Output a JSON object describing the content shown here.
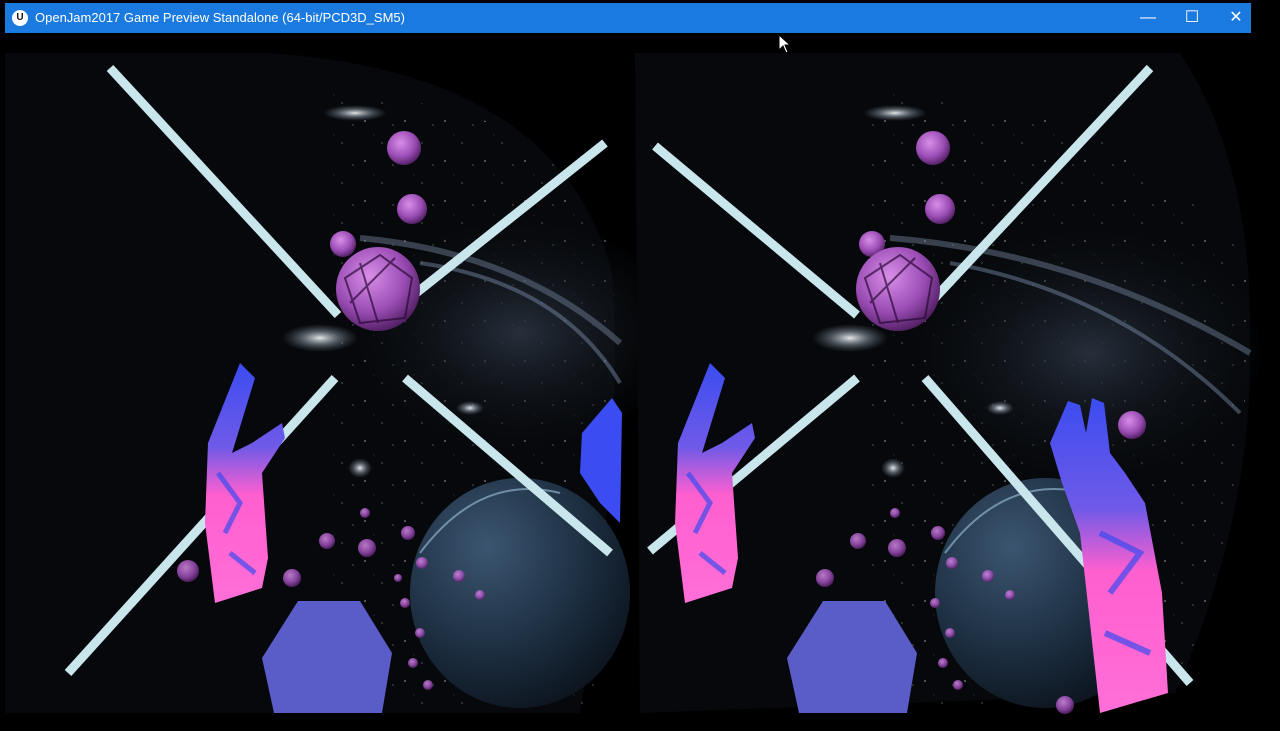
{
  "window": {
    "title": "OpenJam2017 Game Preview Standalone (64-bit/PCD3D_SM5)",
    "app_icon_glyph": "U",
    "icons": {
      "app": "unreal-engine-icon",
      "minimize": "minimize-icon",
      "maximize": "maximize-icon",
      "close": "close-icon",
      "cursor": "mouse-cursor-icon"
    },
    "controls": {
      "minimize_glyph": "—",
      "maximize_glyph": "☐",
      "close_glyph": "✕"
    },
    "colors": {
      "titlebar": "#1a7ae0",
      "background": "#000000"
    }
  },
  "scene": {
    "view": "stereoscopic-vr-preview",
    "eyes": [
      "left-eye",
      "right-eye"
    ],
    "colors": {
      "beam": "#c9e6ec",
      "orb": "#b060c8",
      "hand_pink": "#ff5fcf",
      "hand_blue": "#3b4cf0",
      "octagon": "#5a5cc8",
      "planet": "#1e3247"
    }
  }
}
